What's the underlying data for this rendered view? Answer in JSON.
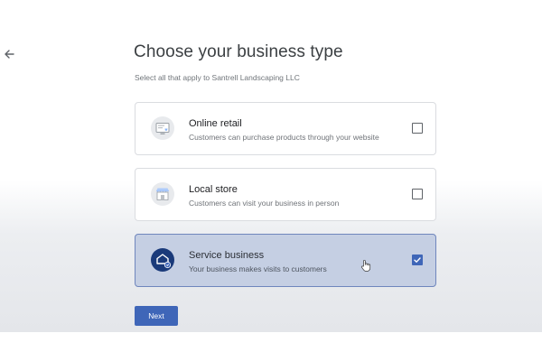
{
  "page": {
    "title": "Choose your business type",
    "subtitle": "Select all that apply to Santrell Landscaping LLC"
  },
  "options": [
    {
      "title": "Online retail",
      "description": "Customers can purchase products through your website",
      "checked": false,
      "icon": "online-retail-icon"
    },
    {
      "title": "Local store",
      "description": "Customers can visit your business in person",
      "checked": false,
      "icon": "storefront-icon"
    },
    {
      "title": "Service business",
      "description": "Your business makes visits to customers",
      "checked": true,
      "icon": "service-vehicle-icon"
    }
  ],
  "actions": {
    "next_label": "Next"
  },
  "colors": {
    "accent": "#3f66b8",
    "selected_bg": "#c5cfe3",
    "selected_border": "#6f86bd"
  }
}
